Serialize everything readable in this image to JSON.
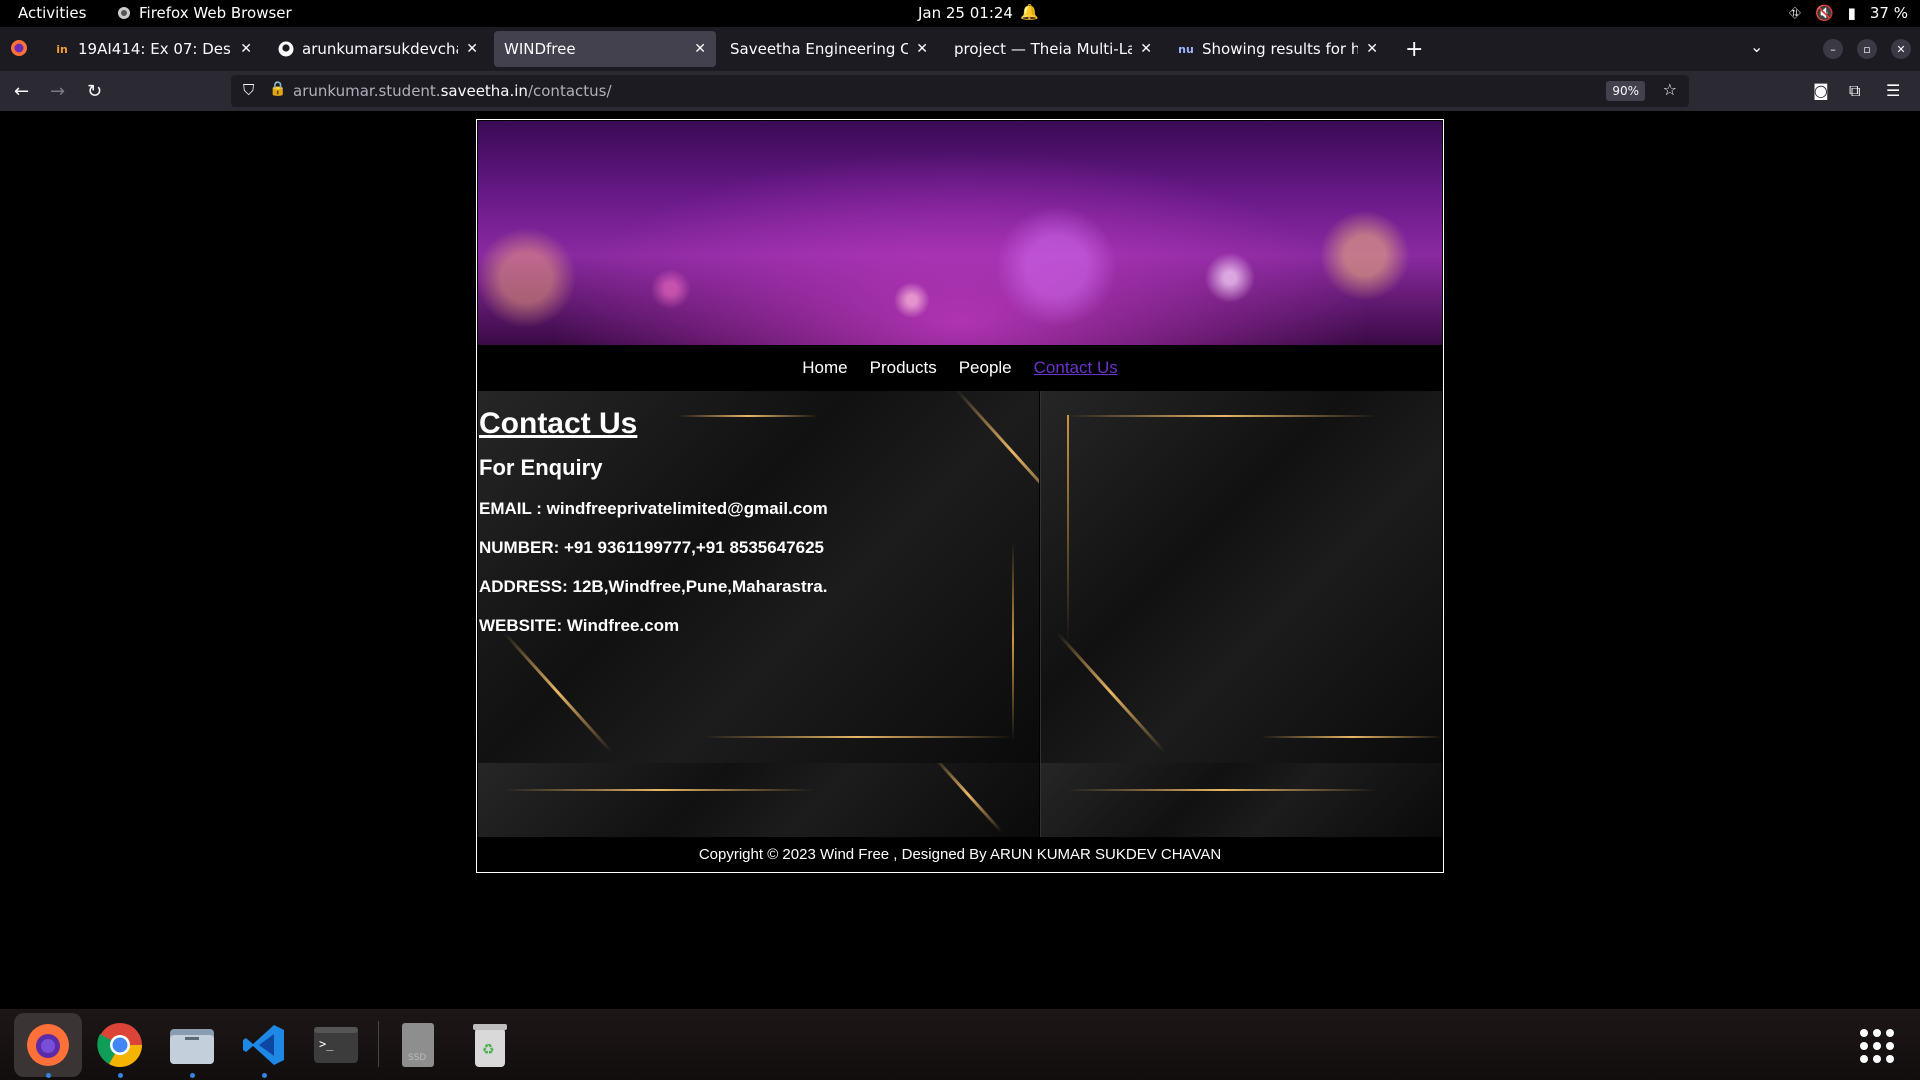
{
  "system": {
    "activities": "Activities",
    "app_name": "Firefox Web Browser",
    "clock": "Jan 25  01:24",
    "battery": "37 %"
  },
  "tabs": [
    {
      "title": "19AI414: Ex 07: Design a",
      "favicon": "in"
    },
    {
      "title": "arunkumarsukdevchavan",
      "favicon": "github-icon"
    },
    {
      "title": "WINDfree",
      "favicon": ""
    },
    {
      "title": "Saveetha Engineering Colleg",
      "favicon": ""
    },
    {
      "title": "project — Theia Multi-Langu",
      "favicon": ""
    },
    {
      "title": "Showing results for http",
      "favicon": "nu"
    }
  ],
  "urlbar": {
    "prefix": "arunkumar.student.",
    "domain": "saveetha.in",
    "path": "/contactus/",
    "zoom": "90%"
  },
  "site": {
    "menu": [
      "Home",
      "Products",
      "People",
      "Contact Us"
    ],
    "heading": "Contact Us",
    "subheading": "For Enquiry",
    "email": "EMAIL : windfreeprivatelimited@gmail.com",
    "number": "NUMBER: +91 9361199777,+91 8535647625",
    "address": "ADDRESS: 12B,Windfree,Pune,Maharastra.",
    "website": "WEBSITE: Windfree.com",
    "footer": "Copyright © 2023 Wind Free , Designed By ARUN KUMAR SUKDEV CHAVAN"
  },
  "dock": [
    "firefox-icon",
    "chrome-icon",
    "files-icon",
    "vscode-icon",
    "terminal-icon",
    "ssd-icon",
    "trash-icon"
  ],
  "colors": {
    "accent_link": "#6a33c8",
    "gold": "#e9b765"
  }
}
